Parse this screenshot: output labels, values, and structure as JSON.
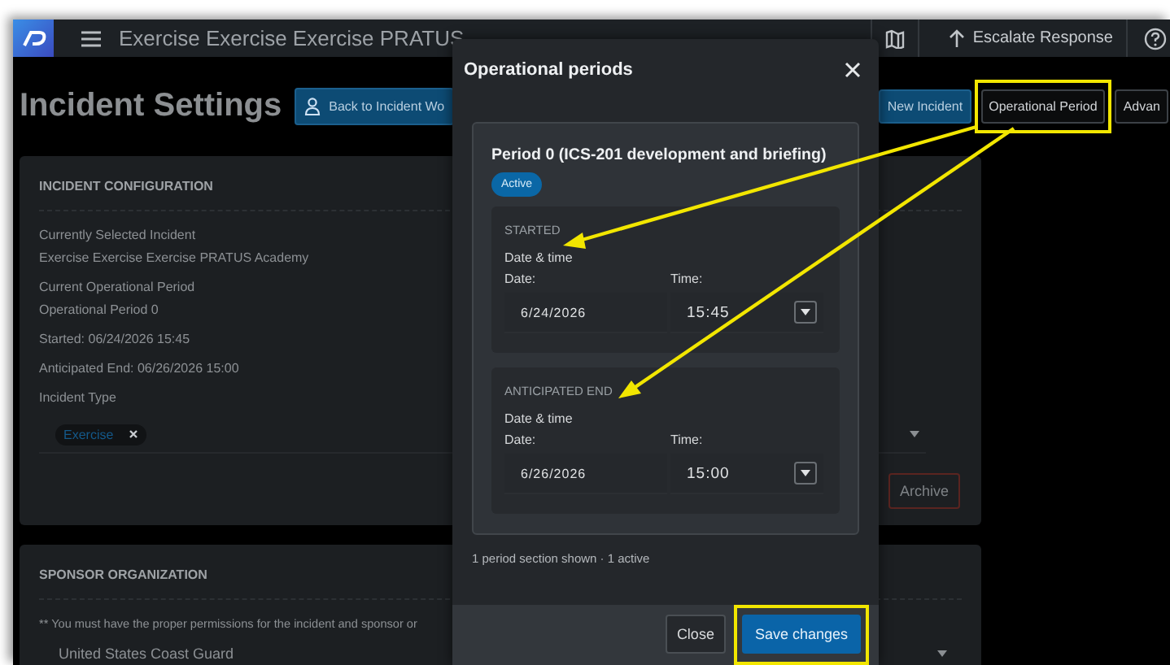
{
  "topbar": {
    "title": "Exercise Exercise Exercise PRATUS",
    "escalate_button": "Escalate Response"
  },
  "header": {
    "title": "Incident Settings",
    "back_button": "Back to Incident Wo",
    "buttons": [
      {
        "label": "New Incident",
        "kind": "primary",
        "highlighted": false
      },
      {
        "label": "Operational Period",
        "kind": "outline",
        "highlighted": true
      },
      {
        "label": "Advan",
        "kind": "outline",
        "highlighted": false
      }
    ]
  },
  "incident_configuration": {
    "heading": "INCIDENT CONFIGURATION",
    "fields": [
      {
        "label": "Currently Selected Incident",
        "value": "Exercise Exercise Exercise PRATUS Academy"
      },
      {
        "label": "Current Operational Period",
        "value": "Operational Period 0"
      }
    ],
    "lines": [
      "Started: 06/24/2026 15:45",
      "Anticipated End: 06/26/2026 15:00"
    ],
    "incident_type_label": "Incident Type",
    "tags": [
      "Exercise"
    ],
    "archive_button": "Archive"
  },
  "sponsor_organization": {
    "heading": "SPONSOR ORGANIZATION",
    "note": "** You must have the proper permissions for the incident and sponsor or",
    "value": "United States Coast Guard"
  },
  "modal": {
    "title": "Operational periods",
    "period": {
      "title": "Period 0 (ICS-201 development and briefing)",
      "status": "Active",
      "sections": [
        {
          "heading": "STARTED",
          "subheading": "Date & time",
          "date_label": "Date:",
          "time_label": "Time:",
          "date": "6/24/2026",
          "time": "15:45"
        },
        {
          "heading": "ANTICIPATED END",
          "subheading": "Date & time",
          "date_label": "Date:",
          "time_label": "Time:",
          "date": "6/26/2026",
          "time": "15:00"
        }
      ]
    },
    "summary": "1 period section shown · 1 active",
    "buttons": [
      {
        "label": "Close",
        "kind": "secondary",
        "highlighted": false
      },
      {
        "label": "Save changes",
        "kind": "primary",
        "highlighted": true
      }
    ]
  }
}
